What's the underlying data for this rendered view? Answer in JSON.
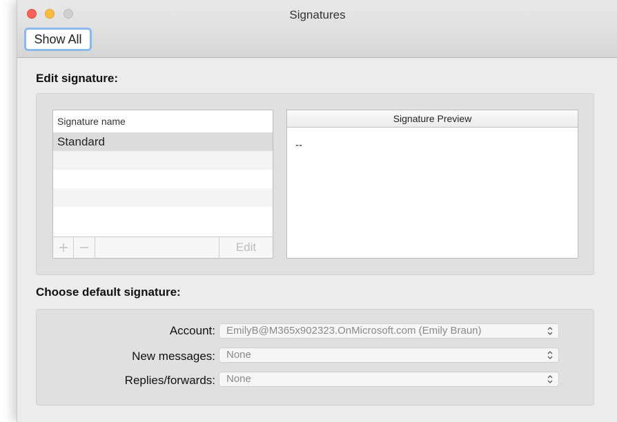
{
  "window": {
    "title": "Signatures",
    "show_all_label": "Show All"
  },
  "edit_signature": {
    "heading": "Edit signature:",
    "list_header": "Signature name",
    "items": [
      "Standard"
    ],
    "add_icon": "plus-icon",
    "remove_icon": "minus-icon",
    "edit_label": "Edit",
    "preview_header": "Signature Preview",
    "preview_text": "--"
  },
  "default_signature": {
    "heading": "Choose default signature:",
    "account_label": "Account:",
    "account_value": "EmilyB@M365x902323.OnMicrosoft.com (Emily Braun)",
    "new_messages_label": "New messages:",
    "new_messages_value": "None",
    "replies_label": "Replies/forwards:",
    "replies_value": "None"
  },
  "colors": {
    "close": "#fc605b",
    "minimize": "#fdbc40",
    "zoom_disabled": "#cfcfcf",
    "focus_ring": "#8ab8f0"
  }
}
